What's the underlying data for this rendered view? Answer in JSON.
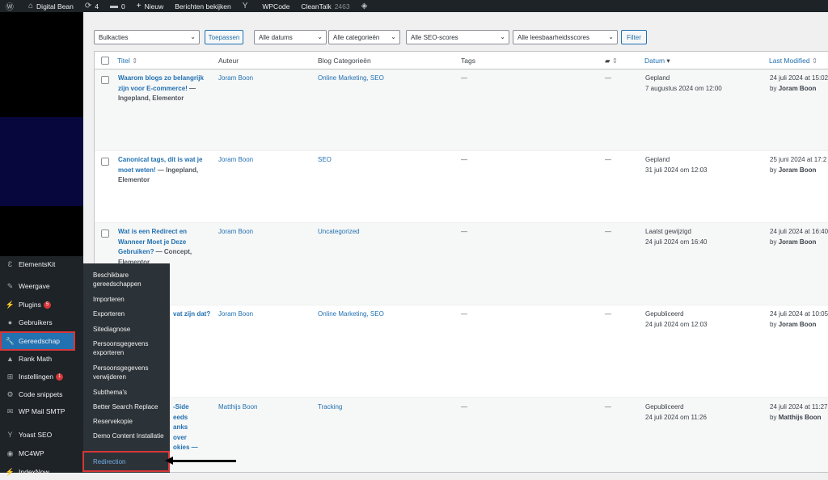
{
  "adminbar": {
    "site_name": "Digital Bean",
    "updates_count": "4",
    "comments_count": "0",
    "new_label": "Nieuw",
    "view_posts": "Berichten bekijken",
    "wpcode": "WPCode",
    "cleantalk": "CleanTalk",
    "cleantalk_count": "2463"
  },
  "menu": {
    "items": [
      {
        "label": "ElementsKit",
        "icon": "elementskit-icon"
      },
      {
        "label": "Weergave",
        "icon": "paintbrush-icon"
      },
      {
        "label": "Plugins",
        "icon": "plugin-icon",
        "badge": "5"
      },
      {
        "label": "Gebruikers",
        "icon": "users-icon"
      },
      {
        "label": "Gereedschap",
        "icon": "wrench-icon"
      },
      {
        "label": "Rank Math",
        "icon": "rankmath-icon"
      },
      {
        "label": "Instellingen",
        "icon": "settings-icon",
        "badge": "1"
      },
      {
        "label": "Code snippets",
        "icon": "code-icon"
      },
      {
        "label": "WP Mail SMTP",
        "icon": "mail-icon"
      },
      {
        "label": "Yoast SEO",
        "icon": "yoast-icon"
      },
      {
        "label": "MC4WP",
        "icon": "mc4wp-icon"
      },
      {
        "label": "IndexNow",
        "icon": "indexnow-icon"
      }
    ]
  },
  "flyout": {
    "items": [
      "Beschikbare gereedschappen",
      "Importeren",
      "Exporteren",
      "Sitediagnose",
      "Persoonsgegevens exporteren",
      "Persoonsgegevens verwijderen",
      "Subthema's",
      "Better Search Replace",
      "Reservekopie",
      "Demo Content Installatie",
      "Redirection"
    ]
  },
  "filters": {
    "bulk": "Bulkacties",
    "apply": "Toepassen",
    "dates": "Alle datums",
    "categories": "Alle categorieën",
    "seo": "Alle SEO-scores",
    "readability": "Alle leesbaarheidsscores",
    "filter": "Filter"
  },
  "table": {
    "headers": {
      "title": "Titel",
      "author": "Auteur",
      "categories": "Blog Categorieën",
      "tags": "Tags",
      "comments": "comment-icon",
      "date": "Datum",
      "modified": "Last Modified"
    },
    "rows": [
      {
        "title": "Waarom blogs zo belangrijk zijn voor E-commerce!",
        "state": " — Ingepland, Elementor",
        "author": "Joram Boon",
        "cats": "Online Marketing, SEO",
        "tags": "—",
        "comments": "—",
        "status": "Gepland",
        "date": "7 augustus 2024 om 12:00",
        "mod": "24 juli 2024 at 15:02",
        "by": "Joram Boon"
      },
      {
        "title": "Canonical tags, dit is wat je moet weten!",
        "state": " — Ingepland, Elementor",
        "author": "Joram Boon",
        "cats": "SEO",
        "tags": "—",
        "comments": "—",
        "status": "Gepland",
        "date": "31 juli 2024 om 12:03",
        "mod": "25 juni 2024 at 17:2",
        "by": "Joram Boon"
      },
      {
        "title": "Wat is een Redirect en Wanneer Moet je Deze Gebruiken?",
        "state": " — Concept, Elementor",
        "author": "Joram Boon",
        "cats": "Uncategorized",
        "tags": "—",
        "comments": "—",
        "status": "Laatst gewijzigd",
        "date": "24 juli 2024 om 16:40",
        "mod": "24 juli 2024 at 16:40",
        "by": "Joram Boon"
      },
      {
        "title": "vat zijn dat?",
        "state": "",
        "author": "Joram Boon",
        "cats": "Online Marketing, SEO",
        "tags": "—",
        "comments": "—",
        "status": "Gepubliceerd",
        "date": "24 juli 2024 om 12:03",
        "mod": "24 juli 2024 at 10:05",
        "by": "Joram Boon"
      },
      {
        "title": "-Side eeds anks over okies —",
        "state": "",
        "author": "Matthijs Boon",
        "cats": "Tracking",
        "tags": "—",
        "comments": "—",
        "status": "Gepubliceerd",
        "date": "24 juli 2024 om 11:26",
        "mod": "24 juli 2024 at 11:27",
        "by": "Matthijs Boon"
      }
    ],
    "by_prefix": "by"
  }
}
